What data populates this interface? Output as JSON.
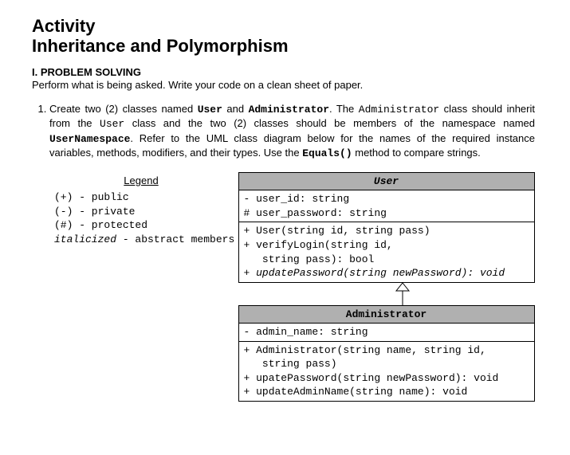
{
  "title_line1": "Activity",
  "title_line2": "Inheritance and Polymorphism",
  "section_heading": "I. PROBLEM SOLVING",
  "section_sub": "Perform what is being asked. Write your code on a clean sheet of paper.",
  "problem1": {
    "pre1": "Create two (2) classes named ",
    "c1": "User",
    "mid1": " and ",
    "c2": "Administrator",
    "mid2": ". The ",
    "c3": "Administrator",
    "mid3": " class should inherit from the ",
    "c4": "User",
    "mid4": " class and the two (2) classes should be members of the namespace named ",
    "c5": "UserNamespace",
    "mid5": ". Refer to the UML class diagram below for the names of the required instance variables, methods, modifiers, and their types. Use the ",
    "c6": "Equals()",
    "tail": " method to compare strings."
  },
  "legend": {
    "title": "Legend",
    "l1": "(+) - public",
    "l2": "(-) - private",
    "l3": "(#) - protected",
    "l4_a": "italicized",
    "l4_b": " - abstract members"
  },
  "uml_user": {
    "title": "User",
    "f1": "- user_id: string",
    "f2": "# user_password: string",
    "m1": "+ User(string id, string pass)",
    "m2a": "+ verifyLogin(string id,",
    "m2b": "   string pass): bool",
    "m3": "+ updatePassword(string newPassword): void"
  },
  "uml_admin": {
    "title": "Administrator",
    "f1": "- admin_name: string",
    "m1a": "+ Administrator(string name, string id,",
    "m1b": "   string pass)",
    "m2": "+ upatePassword(string newPassword): void",
    "m3": "+ updateAdminName(string name): void"
  }
}
